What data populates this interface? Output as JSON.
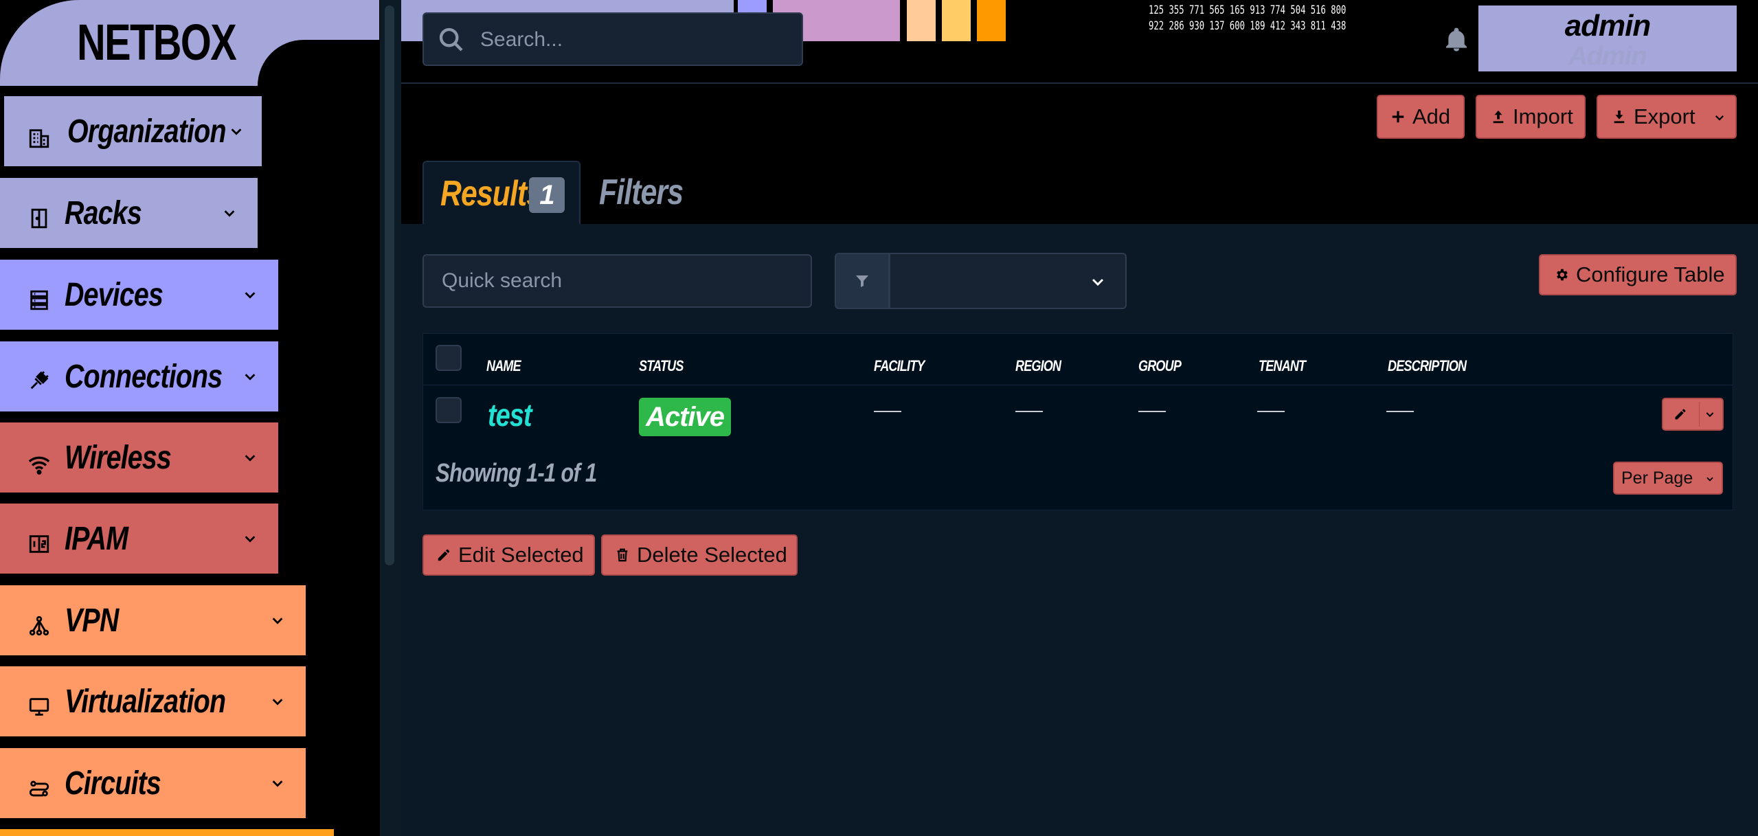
{
  "sidebar": {
    "logo": "NETBOX",
    "items": [
      {
        "label": "Organization",
        "icon": "office-building-icon",
        "color": "#a5a6da"
      },
      {
        "label": "Racks",
        "icon": "door-icon",
        "color": "#a5a6da"
      },
      {
        "label": "Devices",
        "icon": "server-icon",
        "color": "#9c9cfe"
      },
      {
        "label": "Connections",
        "icon": "cable-plug-icon",
        "color": "#9c9cfe"
      },
      {
        "label": "Wireless",
        "icon": "wifi-icon",
        "color": "#d0635f"
      },
      {
        "label": "IPAM",
        "icon": "ip-counter-icon",
        "color": "#d0635f"
      },
      {
        "label": "VPN",
        "icon": "network-nodes-icon",
        "color": "#ff9966"
      },
      {
        "label": "Virtualization",
        "icon": "monitor-icon",
        "color": "#ff9966"
      },
      {
        "label": "Circuits",
        "icon": "transit-connection-icon",
        "color": "#ff9966"
      }
    ]
  },
  "header": {
    "search_placeholder": "Search...",
    "numbers_line1": "125 355 771 565 165 913 774 504 516 800",
    "numbers_line2": "922 286 930 137 600 189 412 343 811 438",
    "user_name": "admin",
    "user_role": "Admin"
  },
  "toolbar": {
    "add_label": "Add",
    "import_label": "Import",
    "export_label": "Export"
  },
  "tabs": {
    "results_label": "Results",
    "results_count": "1",
    "filters_label": "Filters"
  },
  "table_controls": {
    "quick_search_placeholder": "Quick search",
    "configure_label": "Configure Table"
  },
  "table": {
    "columns": [
      "NAME",
      "STATUS",
      "FACILITY",
      "REGION",
      "GROUP",
      "TENANT",
      "DESCRIPTION"
    ],
    "rows": [
      {
        "name": "test",
        "status": "Active",
        "facility": "—",
        "region": "—",
        "group": "—",
        "tenant": "—",
        "description": "—"
      }
    ],
    "showing": "Showing 1-1 of 1",
    "per_page_label": "Per Page"
  },
  "bulk": {
    "edit_label": "Edit Selected",
    "delete_label": "Delete Selected"
  },
  "colors": {
    "accent_red": "#d0635f",
    "lavender": "#a5a6da",
    "periwinkle": "#9c9cfe",
    "orange": "#ff9966",
    "status_active": "#2fb84a",
    "link_cyan": "#23e0d3",
    "tab_active": "#f5a623"
  }
}
